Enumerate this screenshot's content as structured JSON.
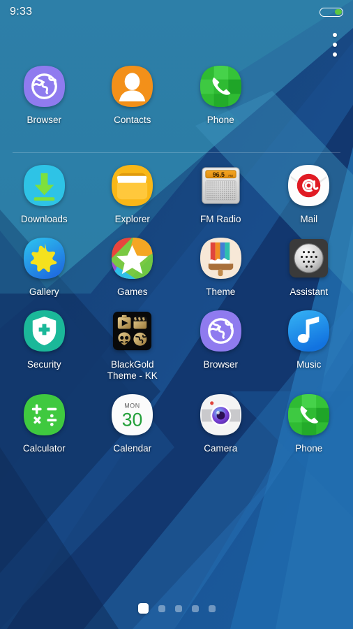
{
  "status_bar": {
    "time": "9:33",
    "battery_icon": "battery-icon",
    "battery_level_percent": 32,
    "battery_color": "#5ec740"
  },
  "overflow_menu": {
    "icon": "more-vertical-icon",
    "label": "More options"
  },
  "wallpaper": {
    "name": "geometric-blue-diagonal-wallpaper",
    "colors": [
      "#2b7ba4",
      "#2e84ad",
      "#1d4f86",
      "#153f74",
      "#0f2d5c",
      "#1b60a0",
      "#3a93bd"
    ]
  },
  "grid": {
    "rows": [
      {
        "apps": [
          {
            "label": "Browser",
            "icon": "browser-globe-icon",
            "bg": "#8f7bef"
          },
          {
            "label": "Contacts",
            "icon": "contacts-person-icon",
            "bg": "#f39019"
          },
          {
            "label": "Phone",
            "icon": "phone-handset-icon",
            "bg": "#2fbb33"
          }
        ]
      },
      {
        "apps": [
          {
            "label": "Downloads",
            "icon": "download-arrow-icon",
            "bg": "#2ec3e6"
          },
          {
            "label": "Explorer",
            "icon": "file-folder-icon",
            "bg": "#f9b717"
          },
          {
            "label": "FM Radio",
            "icon": "fm-radio-icon",
            "bg": "#d8d8d8",
            "display": "96.5",
            "display_unit": "FM"
          },
          {
            "label": "Mail",
            "icon": "mail-at-icon",
            "bg": "#ffffff"
          }
        ]
      },
      {
        "apps": [
          {
            "label": "Gallery",
            "icon": "gallery-leaf-icon",
            "bg": "#2bb7ea"
          },
          {
            "label": "Games",
            "icon": "games-star-icon",
            "bg": "#7ac943"
          },
          {
            "label": "Theme",
            "icon": "theme-paintbrush-icon",
            "bg": "#f6e7d6"
          },
          {
            "label": "Assistant",
            "icon": "assistant-speaker-icon",
            "bg": "#3a3a3a"
          }
        ]
      },
      {
        "apps": [
          {
            "label": "Security",
            "icon": "security-shield-icon",
            "bg": "#1bb899"
          },
          {
            "label": "BlackGold\nTheme - KK",
            "icon": "blackgold-theme-icon",
            "bg": "#0a0a0a"
          },
          {
            "label": "Browser",
            "icon": "browser-globe-icon",
            "bg": "#8f7bef"
          },
          {
            "label": "Music",
            "icon": "music-note-icon",
            "bg": "#2196f3"
          }
        ]
      },
      {
        "apps": [
          {
            "label": "Calculator",
            "icon": "calculator-icon",
            "bg": "#3fc93f",
            "symbols": [
              "+",
              "−",
              "×",
              "÷"
            ]
          },
          {
            "label": "Calendar",
            "icon": "calendar-icon",
            "bg": "#ffffff",
            "weekday": "MON",
            "day": "30"
          },
          {
            "label": "Camera",
            "icon": "camera-lens-icon",
            "bg": "#f2f2f2"
          },
          {
            "label": "Phone",
            "icon": "phone-handset-icon",
            "bg": "#2fbb33"
          }
        ]
      }
    ]
  },
  "page_indicator": {
    "total_pages": 5,
    "current_page": 1,
    "dots": [
      "page-1",
      "page-2",
      "page-3",
      "page-4",
      "page-5"
    ]
  }
}
